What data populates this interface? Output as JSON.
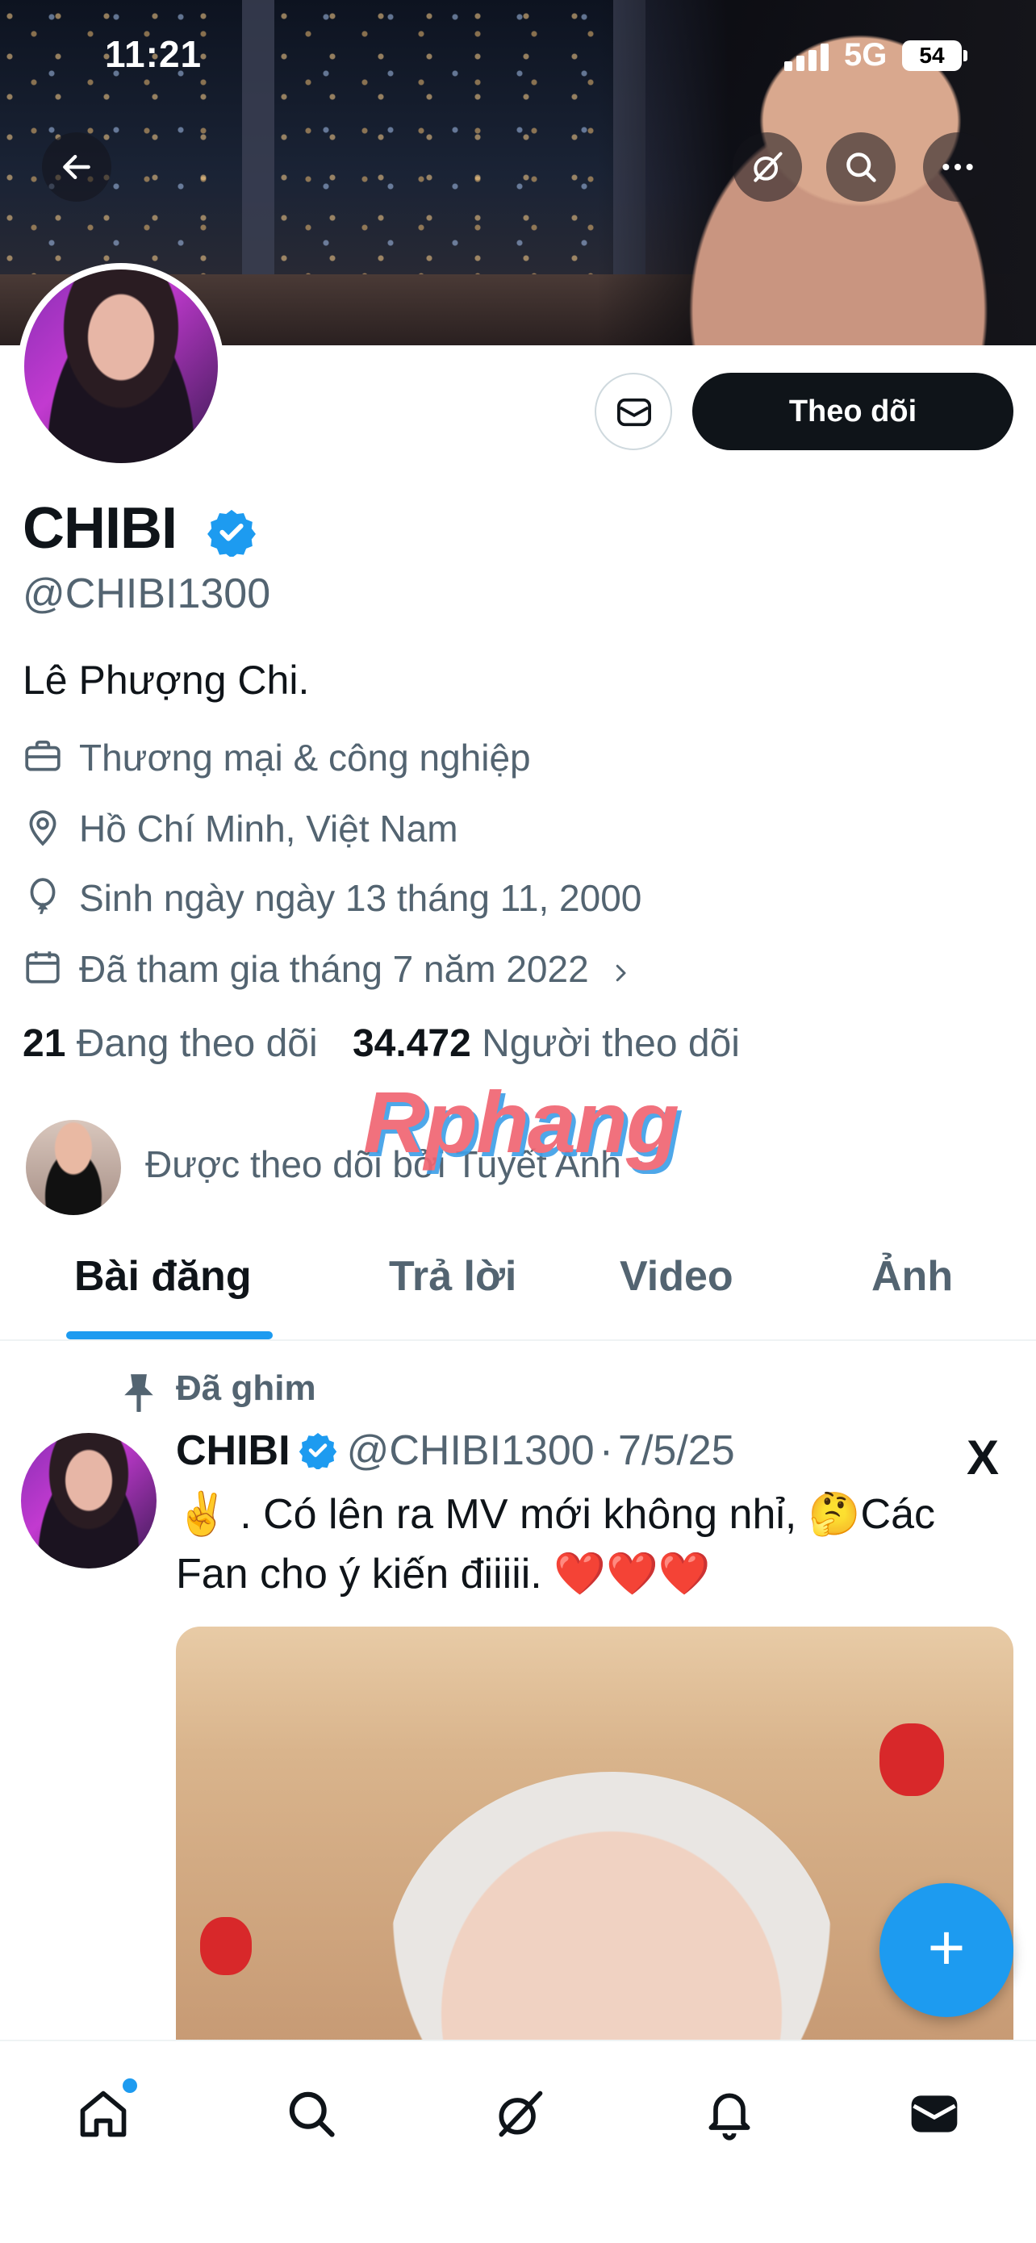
{
  "status_bar": {
    "time": "11:21",
    "network": "5G",
    "battery": "54"
  },
  "profile": {
    "name": "CHIBI",
    "handle": "@CHIBI1300",
    "bio": "Lê Phượng Chi.",
    "category": "Thương mại & công nghiệp",
    "location": "Hồ Chí Minh, Việt Nam",
    "birthday": "Sinh ngày ngày 13 tháng 11, 2000",
    "joined": "Đã tham gia tháng 7 năm 2022",
    "following_count": "21",
    "following_label": "Đang theo dõi",
    "followers_count": "34.472",
    "followers_label": "Người theo dõi",
    "followed_by": "Được theo dõi bởi Tuyết Anh",
    "follow_button": "Theo dõi"
  },
  "watermark": "Rphang",
  "tabs": [
    {
      "label": "Bài đăng",
      "active": true
    },
    {
      "label": "Trả lời",
      "active": false
    },
    {
      "label": "Video",
      "active": false
    },
    {
      "label": "Ảnh",
      "active": false
    }
  ],
  "post": {
    "pinned_label": "Đã ghim",
    "author_name": "CHIBI",
    "author_handle": "@CHIBI1300",
    "separator": "·",
    "date": "7/5/25",
    "text": "✌️ . Có lên ra MV mới không nhỉ, 🤔Các Fan cho ý kiến điiiii. ❤️❤️❤️",
    "source_logo": "X"
  },
  "fab_label": "+",
  "icons": {
    "back": "arrow-left-icon",
    "grok": "grok-icon",
    "search": "search-icon",
    "more": "more-icon",
    "message": "envelope-icon",
    "verified": "verified-badge-icon",
    "briefcase": "briefcase-icon",
    "location": "location-pin-icon",
    "balloon": "balloon-icon",
    "calendar": "calendar-icon",
    "chevron": "chevron-right-icon",
    "pin": "pin-icon",
    "home": "home-icon",
    "notifications": "bell-icon",
    "messages": "mail-icon"
  },
  "colors": {
    "accent": "#1d9bf0",
    "text": "#0f1419",
    "muted": "#536471",
    "verified": "#1d9bf0"
  }
}
